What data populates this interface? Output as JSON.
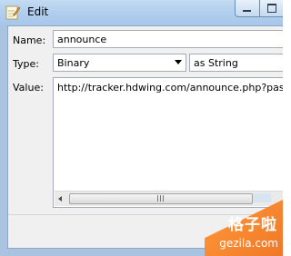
{
  "window": {
    "title": "Edit",
    "title_icon": "notepad-pencil-icon",
    "buttons": {
      "minimize_icon": "minimize-icon",
      "maximize_icon": "maximize-icon"
    }
  },
  "form": {
    "name_label": "Name:",
    "name_value": "announce",
    "type_label": "Type:",
    "type_value": "Binary",
    "format_value": "as String",
    "value_label": "Value:",
    "value_text": "http://tracker.hdwing.com/announce.php?passkey"
  },
  "scrollbar": {
    "grip_label": "III"
  },
  "watermark": {
    "text_cn": "格子啦",
    "url": "gezila.com",
    "color": "#f07828"
  }
}
